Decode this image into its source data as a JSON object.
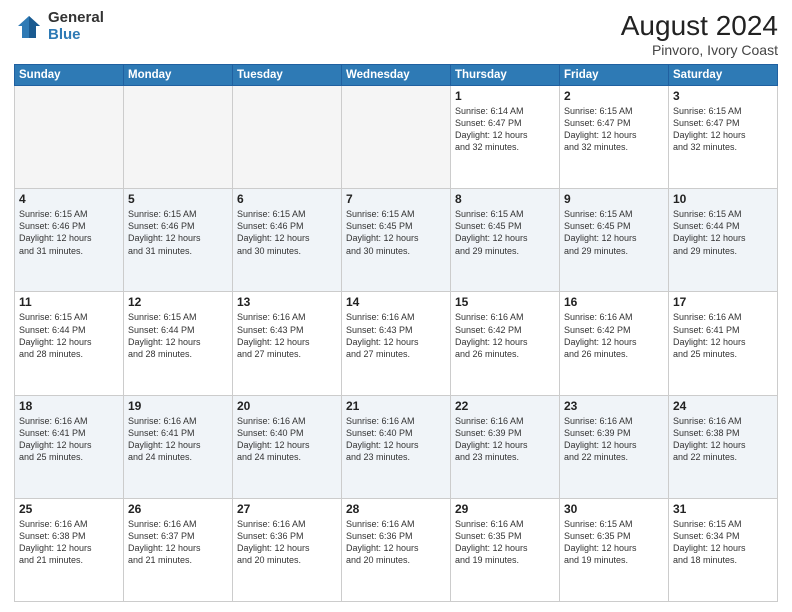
{
  "header": {
    "logo": {
      "line1": "General",
      "line2": "Blue"
    },
    "title": "August 2024",
    "subtitle": "Pinvoro, Ivory Coast"
  },
  "weekdays": [
    "Sunday",
    "Monday",
    "Tuesday",
    "Wednesday",
    "Thursday",
    "Friday",
    "Saturday"
  ],
  "weeks": [
    [
      {
        "day": "",
        "info": ""
      },
      {
        "day": "",
        "info": ""
      },
      {
        "day": "",
        "info": ""
      },
      {
        "day": "",
        "info": ""
      },
      {
        "day": "1",
        "info": "Sunrise: 6:14 AM\nSunset: 6:47 PM\nDaylight: 12 hours\nand 32 minutes."
      },
      {
        "day": "2",
        "info": "Sunrise: 6:15 AM\nSunset: 6:47 PM\nDaylight: 12 hours\nand 32 minutes."
      },
      {
        "day": "3",
        "info": "Sunrise: 6:15 AM\nSunset: 6:47 PM\nDaylight: 12 hours\nand 32 minutes."
      }
    ],
    [
      {
        "day": "4",
        "info": "Sunrise: 6:15 AM\nSunset: 6:46 PM\nDaylight: 12 hours\nand 31 minutes."
      },
      {
        "day": "5",
        "info": "Sunrise: 6:15 AM\nSunset: 6:46 PM\nDaylight: 12 hours\nand 31 minutes."
      },
      {
        "day": "6",
        "info": "Sunrise: 6:15 AM\nSunset: 6:46 PM\nDaylight: 12 hours\nand 30 minutes."
      },
      {
        "day": "7",
        "info": "Sunrise: 6:15 AM\nSunset: 6:45 PM\nDaylight: 12 hours\nand 30 minutes."
      },
      {
        "day": "8",
        "info": "Sunrise: 6:15 AM\nSunset: 6:45 PM\nDaylight: 12 hours\nand 29 minutes."
      },
      {
        "day": "9",
        "info": "Sunrise: 6:15 AM\nSunset: 6:45 PM\nDaylight: 12 hours\nand 29 minutes."
      },
      {
        "day": "10",
        "info": "Sunrise: 6:15 AM\nSunset: 6:44 PM\nDaylight: 12 hours\nand 29 minutes."
      }
    ],
    [
      {
        "day": "11",
        "info": "Sunrise: 6:15 AM\nSunset: 6:44 PM\nDaylight: 12 hours\nand 28 minutes."
      },
      {
        "day": "12",
        "info": "Sunrise: 6:15 AM\nSunset: 6:44 PM\nDaylight: 12 hours\nand 28 minutes."
      },
      {
        "day": "13",
        "info": "Sunrise: 6:16 AM\nSunset: 6:43 PM\nDaylight: 12 hours\nand 27 minutes."
      },
      {
        "day": "14",
        "info": "Sunrise: 6:16 AM\nSunset: 6:43 PM\nDaylight: 12 hours\nand 27 minutes."
      },
      {
        "day": "15",
        "info": "Sunrise: 6:16 AM\nSunset: 6:42 PM\nDaylight: 12 hours\nand 26 minutes."
      },
      {
        "day": "16",
        "info": "Sunrise: 6:16 AM\nSunset: 6:42 PM\nDaylight: 12 hours\nand 26 minutes."
      },
      {
        "day": "17",
        "info": "Sunrise: 6:16 AM\nSunset: 6:41 PM\nDaylight: 12 hours\nand 25 minutes."
      }
    ],
    [
      {
        "day": "18",
        "info": "Sunrise: 6:16 AM\nSunset: 6:41 PM\nDaylight: 12 hours\nand 25 minutes."
      },
      {
        "day": "19",
        "info": "Sunrise: 6:16 AM\nSunset: 6:41 PM\nDaylight: 12 hours\nand 24 minutes."
      },
      {
        "day": "20",
        "info": "Sunrise: 6:16 AM\nSunset: 6:40 PM\nDaylight: 12 hours\nand 24 minutes."
      },
      {
        "day": "21",
        "info": "Sunrise: 6:16 AM\nSunset: 6:40 PM\nDaylight: 12 hours\nand 23 minutes."
      },
      {
        "day": "22",
        "info": "Sunrise: 6:16 AM\nSunset: 6:39 PM\nDaylight: 12 hours\nand 23 minutes."
      },
      {
        "day": "23",
        "info": "Sunrise: 6:16 AM\nSunset: 6:39 PM\nDaylight: 12 hours\nand 22 minutes."
      },
      {
        "day": "24",
        "info": "Sunrise: 6:16 AM\nSunset: 6:38 PM\nDaylight: 12 hours\nand 22 minutes."
      }
    ],
    [
      {
        "day": "25",
        "info": "Sunrise: 6:16 AM\nSunset: 6:38 PM\nDaylight: 12 hours\nand 21 minutes."
      },
      {
        "day": "26",
        "info": "Sunrise: 6:16 AM\nSunset: 6:37 PM\nDaylight: 12 hours\nand 21 minutes."
      },
      {
        "day": "27",
        "info": "Sunrise: 6:16 AM\nSunset: 6:36 PM\nDaylight: 12 hours\nand 20 minutes."
      },
      {
        "day": "28",
        "info": "Sunrise: 6:16 AM\nSunset: 6:36 PM\nDaylight: 12 hours\nand 20 minutes."
      },
      {
        "day": "29",
        "info": "Sunrise: 6:16 AM\nSunset: 6:35 PM\nDaylight: 12 hours\nand 19 minutes."
      },
      {
        "day": "30",
        "info": "Sunrise: 6:15 AM\nSunset: 6:35 PM\nDaylight: 12 hours\nand 19 minutes."
      },
      {
        "day": "31",
        "info": "Sunrise: 6:15 AM\nSunset: 6:34 PM\nDaylight: 12 hours\nand 18 minutes."
      }
    ]
  ]
}
